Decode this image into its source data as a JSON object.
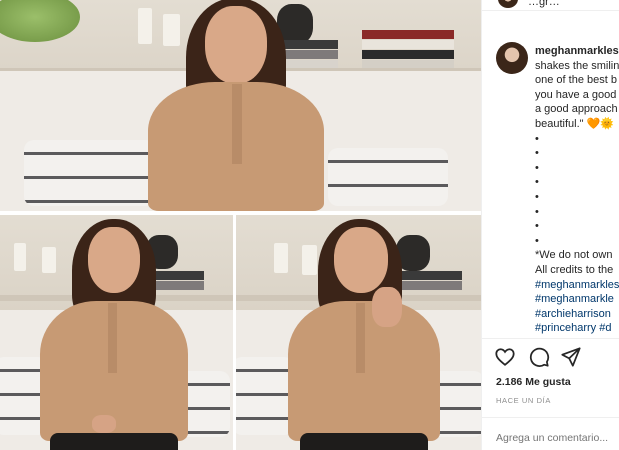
{
  "sidebar": {
    "header_username": "…gr…",
    "caption": {
      "username": "meghanmarkles",
      "lines": [
        "shakes the smilin",
        "one of the best b",
        "you have a good",
        "a good approach",
        "beautiful.\""
      ],
      "emoji_heart": "🧡",
      "emoji_sun": "🌞",
      "dots": [
        "•",
        "•",
        "•",
        "•",
        "•",
        "•",
        "•",
        "•"
      ],
      "disclaimer_1": "*We do not own",
      "disclaimer_2": "All credits to the",
      "hashtags": [
        "#meghanmarkles",
        "#meghanmarkle",
        "#archieharrison",
        "#princeharry #d"
      ]
    },
    "actions": {
      "like_icon": "heart-icon",
      "comment_icon": "comment-icon",
      "share_icon": "share-icon"
    },
    "likes": "2.186 Me gusta",
    "timestamp": "HACE UN DÍA",
    "comment_placeholder": "Agrega un comentario..."
  },
  "colors": {
    "text": "#262626",
    "muted": "#8e8e8e",
    "link": "#00376b",
    "divider": "#efefef"
  }
}
